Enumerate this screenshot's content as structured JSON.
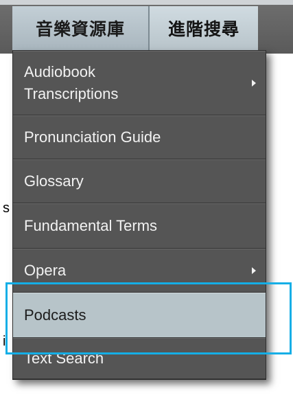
{
  "nav": {
    "tabs": [
      {
        "label": "音樂資源庫",
        "active": true
      },
      {
        "label": "進階搜尋",
        "active": false
      }
    ]
  },
  "menu": {
    "items": [
      {
        "label_line1": "Audiobook",
        "label_line2": "Transcriptions",
        "has_submenu": true
      },
      {
        "label": "Pronunciation Guide",
        "has_submenu": false
      },
      {
        "label": "Glossary",
        "has_submenu": false
      },
      {
        "label": "Fundamental Terms",
        "has_submenu": false
      },
      {
        "label": "Opera",
        "has_submenu": true
      },
      {
        "label": "Podcasts",
        "has_submenu": false,
        "highlighted": true
      },
      {
        "label": "Text Search",
        "has_submenu": false
      }
    ]
  },
  "background_fragments": {
    "frag1": "s",
    "frag2": "i"
  },
  "colors": {
    "menu_bg": "#555555",
    "highlight_bg": "#b7c4c9",
    "tab_active_bg": "#b3c0c7",
    "focus_outline": "#14aee6"
  }
}
